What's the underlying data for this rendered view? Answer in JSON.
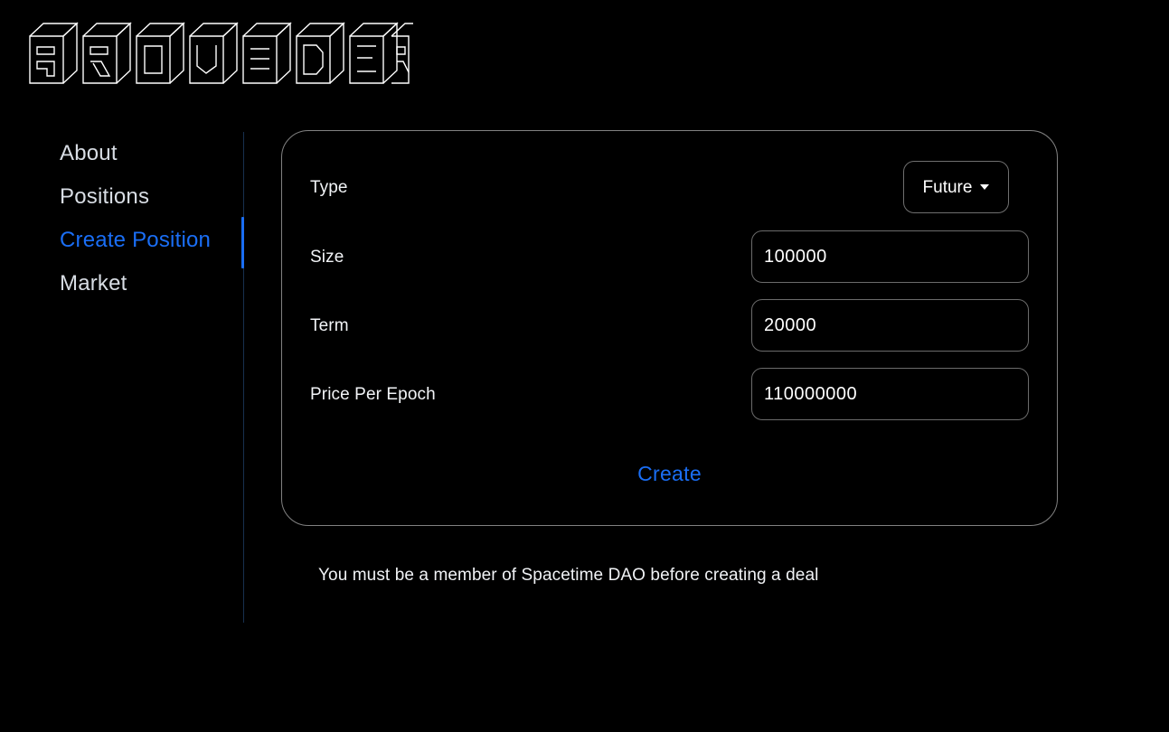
{
  "brand": {
    "logo_text": "PROVIDER",
    "logo_style": "3d-wireframe-isometric"
  },
  "colors": {
    "background": "#000000",
    "accent": "#1a6ef5",
    "text": "#f2f4f7",
    "muted_text": "#d8dde4",
    "border": "#818181",
    "input_border": "#6b6b6b",
    "divider": "#17304f"
  },
  "sidebar": {
    "items": [
      {
        "label": "About",
        "active": false
      },
      {
        "label": "Positions",
        "active": false
      },
      {
        "label": "Create Position",
        "active": true
      },
      {
        "label": "Market",
        "active": false
      }
    ]
  },
  "form": {
    "fields": [
      {
        "label": "Type",
        "control": "select",
        "value": "Future",
        "options": [
          "Future"
        ],
        "caret_icon": "chevron-down-icon"
      },
      {
        "label": "Size",
        "control": "text",
        "value": "100000",
        "placeholder": ""
      },
      {
        "label": "Term",
        "control": "text",
        "value": "20000",
        "placeholder": ""
      },
      {
        "label": "Price Per Epoch",
        "control": "text",
        "value": "110000000",
        "placeholder": ""
      }
    ],
    "submit_label": "Create"
  },
  "footer": {
    "note": "You must be a member of Spacetime DAO before creating a deal"
  }
}
